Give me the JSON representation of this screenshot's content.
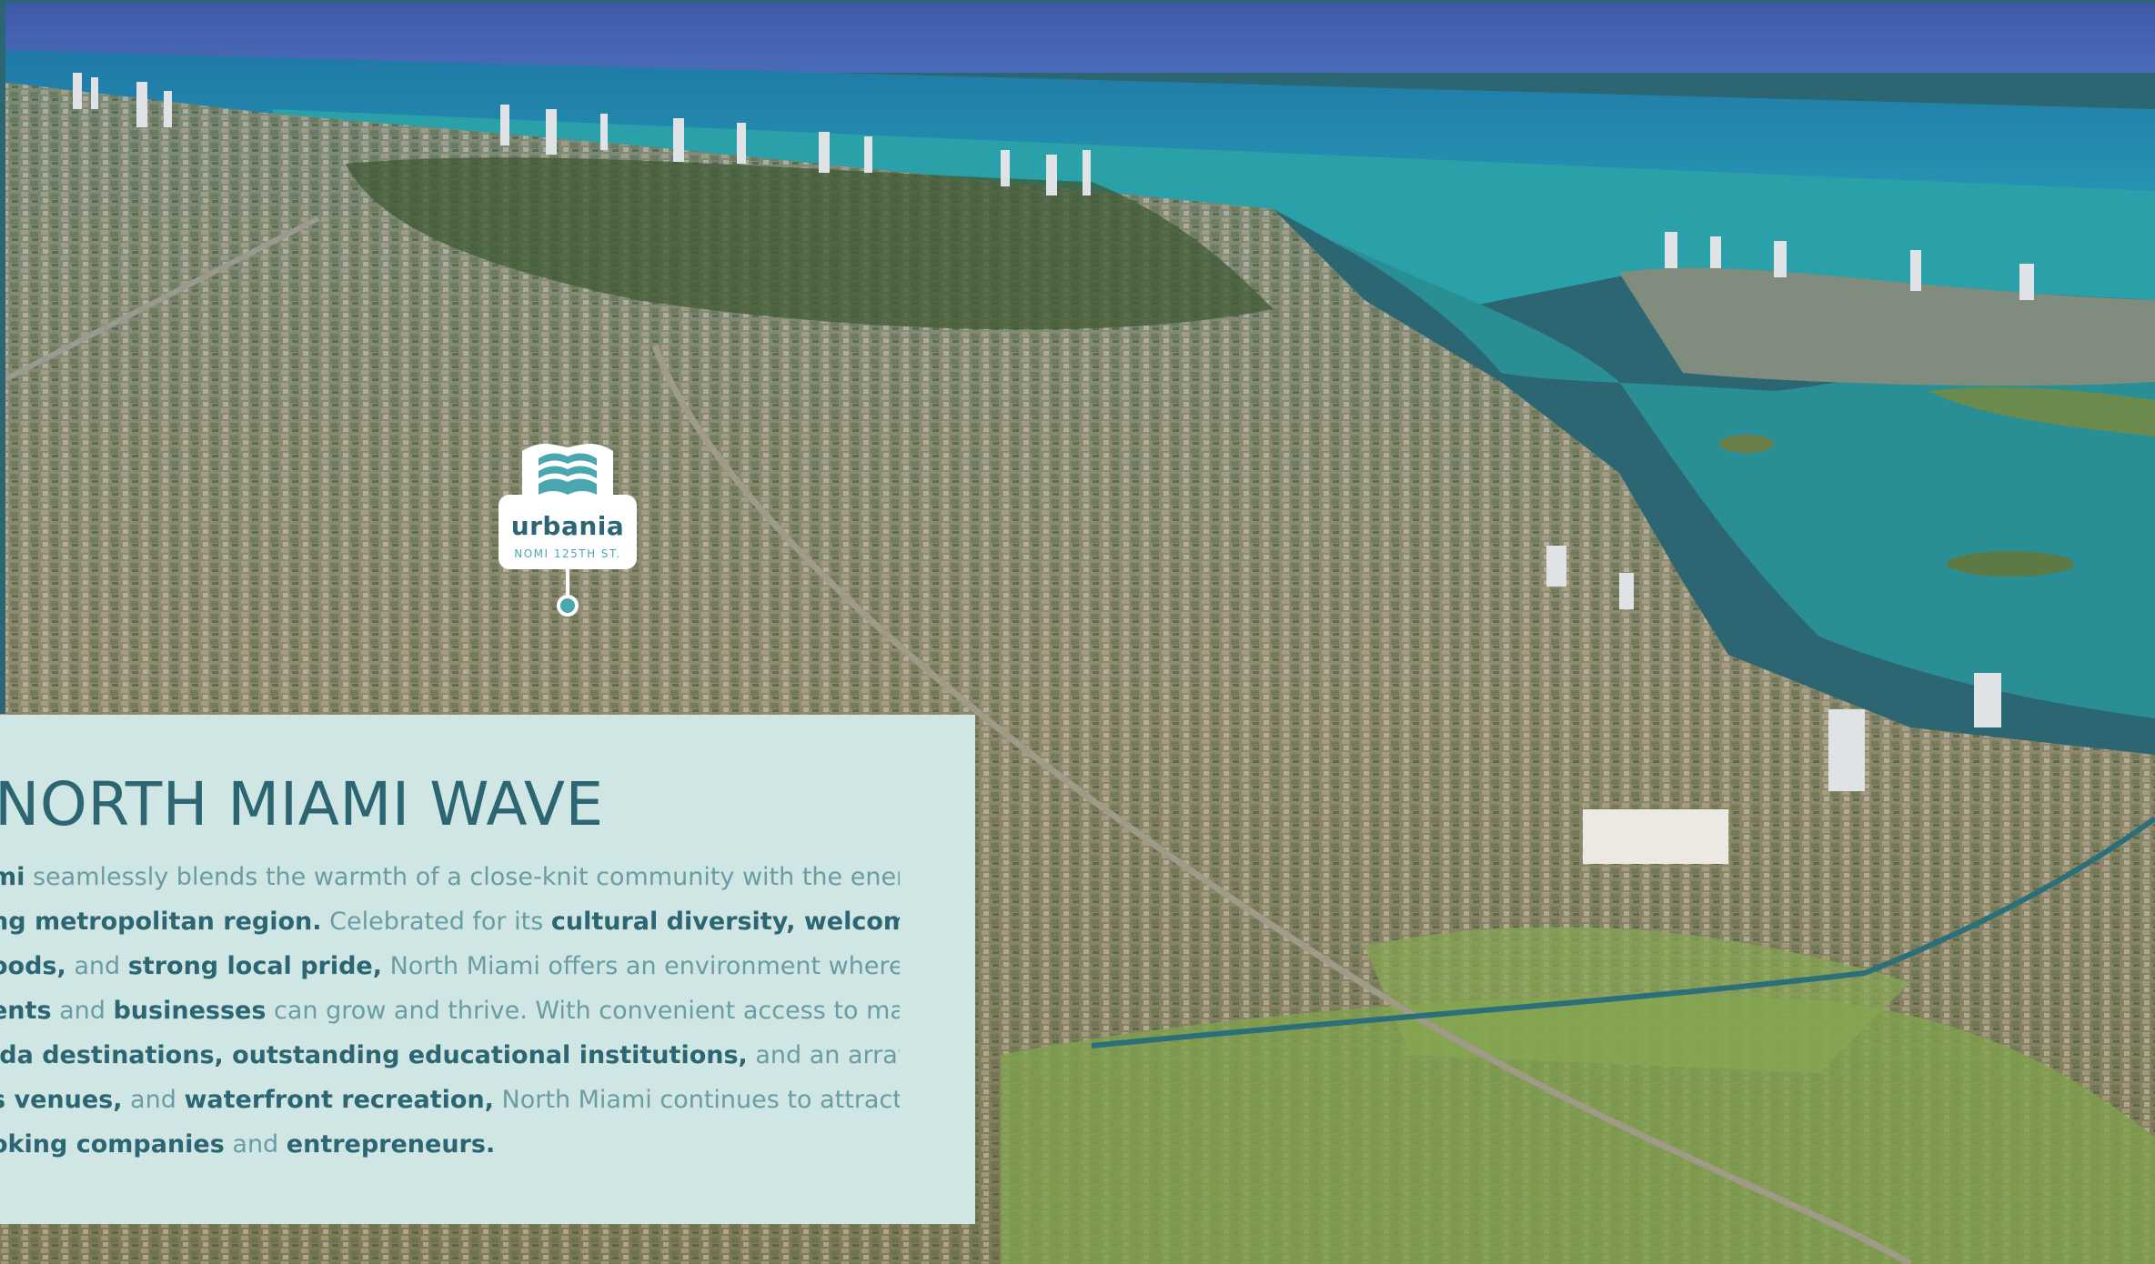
{
  "map": {
    "pin": {
      "brand": "urbania",
      "subtitle": "NOMI 125TH ST."
    }
  },
  "panel": {
    "title": "NORTH MIAMI WAVE",
    "lines": [
      [
        {
          "t": "mi",
          "b": true
        },
        {
          "t": " seamlessly blends the warmth of a close-knit community with the energy",
          "b": false
        }
      ],
      [
        {
          "t": "ng metropolitan region.",
          "b": true
        },
        {
          "t": " Celebrated for its ",
          "b": false
        },
        {
          "t": "cultural diversity, welcoming",
          "b": true
        }
      ],
      [
        {
          "t": "oods,",
          "b": true
        },
        {
          "t": " and ",
          "b": false
        },
        {
          "t": "strong local pride,",
          "b": true
        },
        {
          "t": " North Miami offers an environment where",
          "b": false
        }
      ],
      [
        {
          "t": "ents",
          "b": true
        },
        {
          "t": " and ",
          "b": false
        },
        {
          "t": "businesses",
          "b": true
        },
        {
          "t": " can grow and thrive. With convenient access to major",
          "b": false
        }
      ],
      [
        {
          "t": "ida destinations, outstanding educational institutions,",
          "b": true
        },
        {
          "t": " and an array of",
          "b": false
        }
      ],
      [
        {
          "t": "s venues,",
          "b": true
        },
        {
          "t": " and ",
          "b": false
        },
        {
          "t": "waterfront recreation,",
          "b": true
        },
        {
          "t": " North Miami continues to attract",
          "b": false
        }
      ],
      [
        {
          "t": "oking companies",
          "b": true
        },
        {
          "t": " and ",
          "b": false
        },
        {
          "t": "entrepreneurs.",
          "b": true
        }
      ]
    ]
  }
}
